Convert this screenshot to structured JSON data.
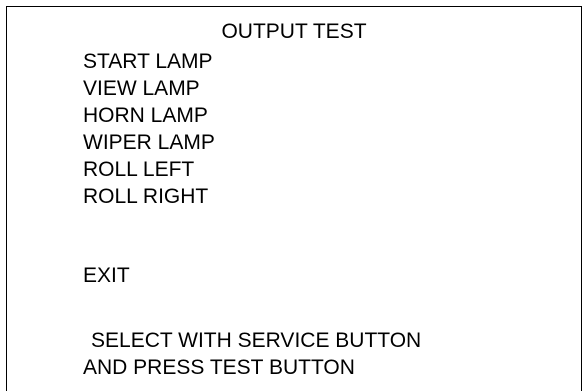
{
  "title": "OUTPUT TEST",
  "menu": {
    "items": [
      {
        "label": "START LAMP"
      },
      {
        "label": "VIEW LAMP"
      },
      {
        "label": "HORN LAMP"
      },
      {
        "label": "WIPER LAMP"
      },
      {
        "label": "ROLL LEFT"
      },
      {
        "label": "ROLL RIGHT"
      }
    ],
    "exit_label": "EXIT"
  },
  "instructions": {
    "line1": "SELECT WITH SERVICE BUTTON",
    "line2": "AND PRESS TEST BUTTON"
  }
}
